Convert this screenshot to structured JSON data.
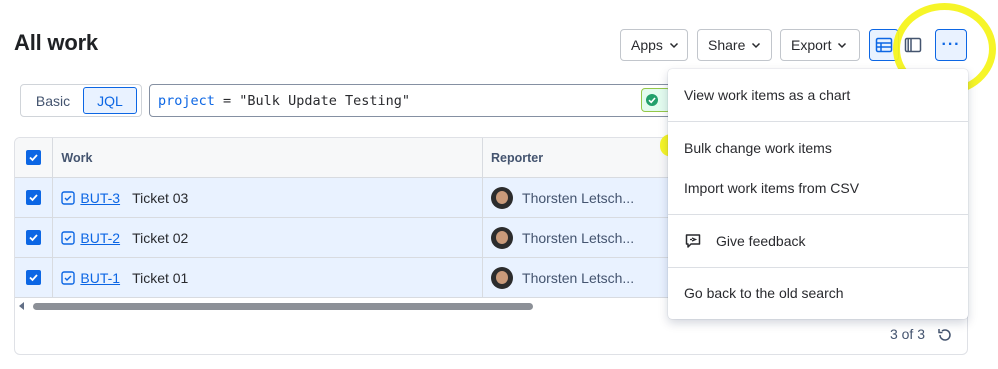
{
  "page": {
    "title": "All work"
  },
  "toolbar": {
    "apps_label": "Apps",
    "share_label": "Share",
    "export_label": "Export",
    "more_label": "···"
  },
  "search": {
    "mode_basic": "Basic",
    "mode_jql": "JQL",
    "jql_keyword": "project",
    "jql_operator": " = ",
    "jql_value": "\"Bulk Update Testing\""
  },
  "table": {
    "columns": [
      "Work",
      "Reporter"
    ],
    "rows": [
      {
        "key": "BUT-3",
        "summary": "Ticket 03",
        "reporter": "Thorsten Letsch..."
      },
      {
        "key": "BUT-2",
        "summary": "Ticket 02",
        "reporter": "Thorsten Letsch..."
      },
      {
        "key": "BUT-1",
        "summary": "Ticket 01",
        "reporter": "Thorsten Letsch..."
      }
    ],
    "count_text": "3 of 3"
  },
  "menu": {
    "items": [
      "View work items as a chart",
      "Bulk change work items",
      "Import work items from CSV",
      "Give feedback",
      "Go back to the old search"
    ]
  },
  "colors": {
    "accent": "#0c66e4",
    "highlight": "#f6f41c",
    "row_selected": "#e9f2ff"
  }
}
